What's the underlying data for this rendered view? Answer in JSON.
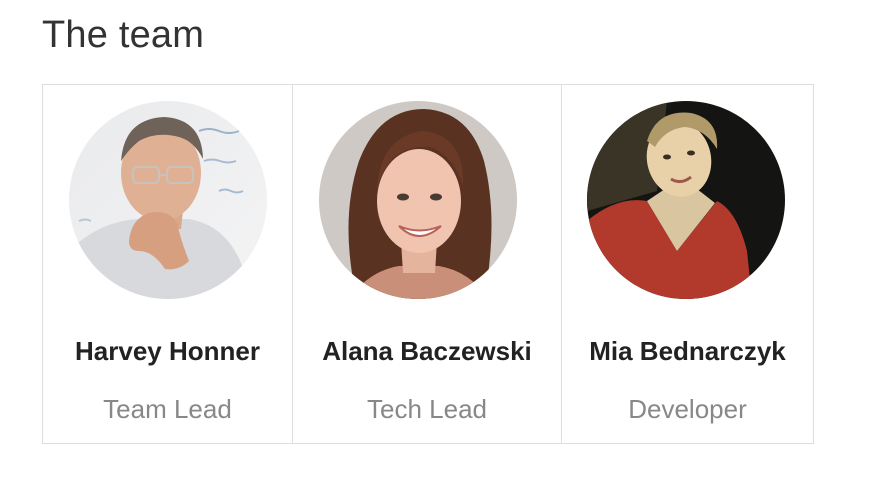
{
  "section": {
    "title": "The team"
  },
  "members": [
    {
      "name": "Harvey Honner",
      "role": "Team Lead",
      "avatar_icon": "avatar-photo-man-glasses"
    },
    {
      "name": "Alana Baczewski",
      "role": "Tech Lead",
      "avatar_icon": "avatar-photo-woman-brown-hair"
    },
    {
      "name": "Mia Bednarczyk",
      "role": "Developer",
      "avatar_icon": "avatar-photo-woman-red-jacket"
    }
  ],
  "colors": {
    "heading": "#333333",
    "name": "#222222",
    "role": "#888888",
    "border": "#dedede"
  }
}
